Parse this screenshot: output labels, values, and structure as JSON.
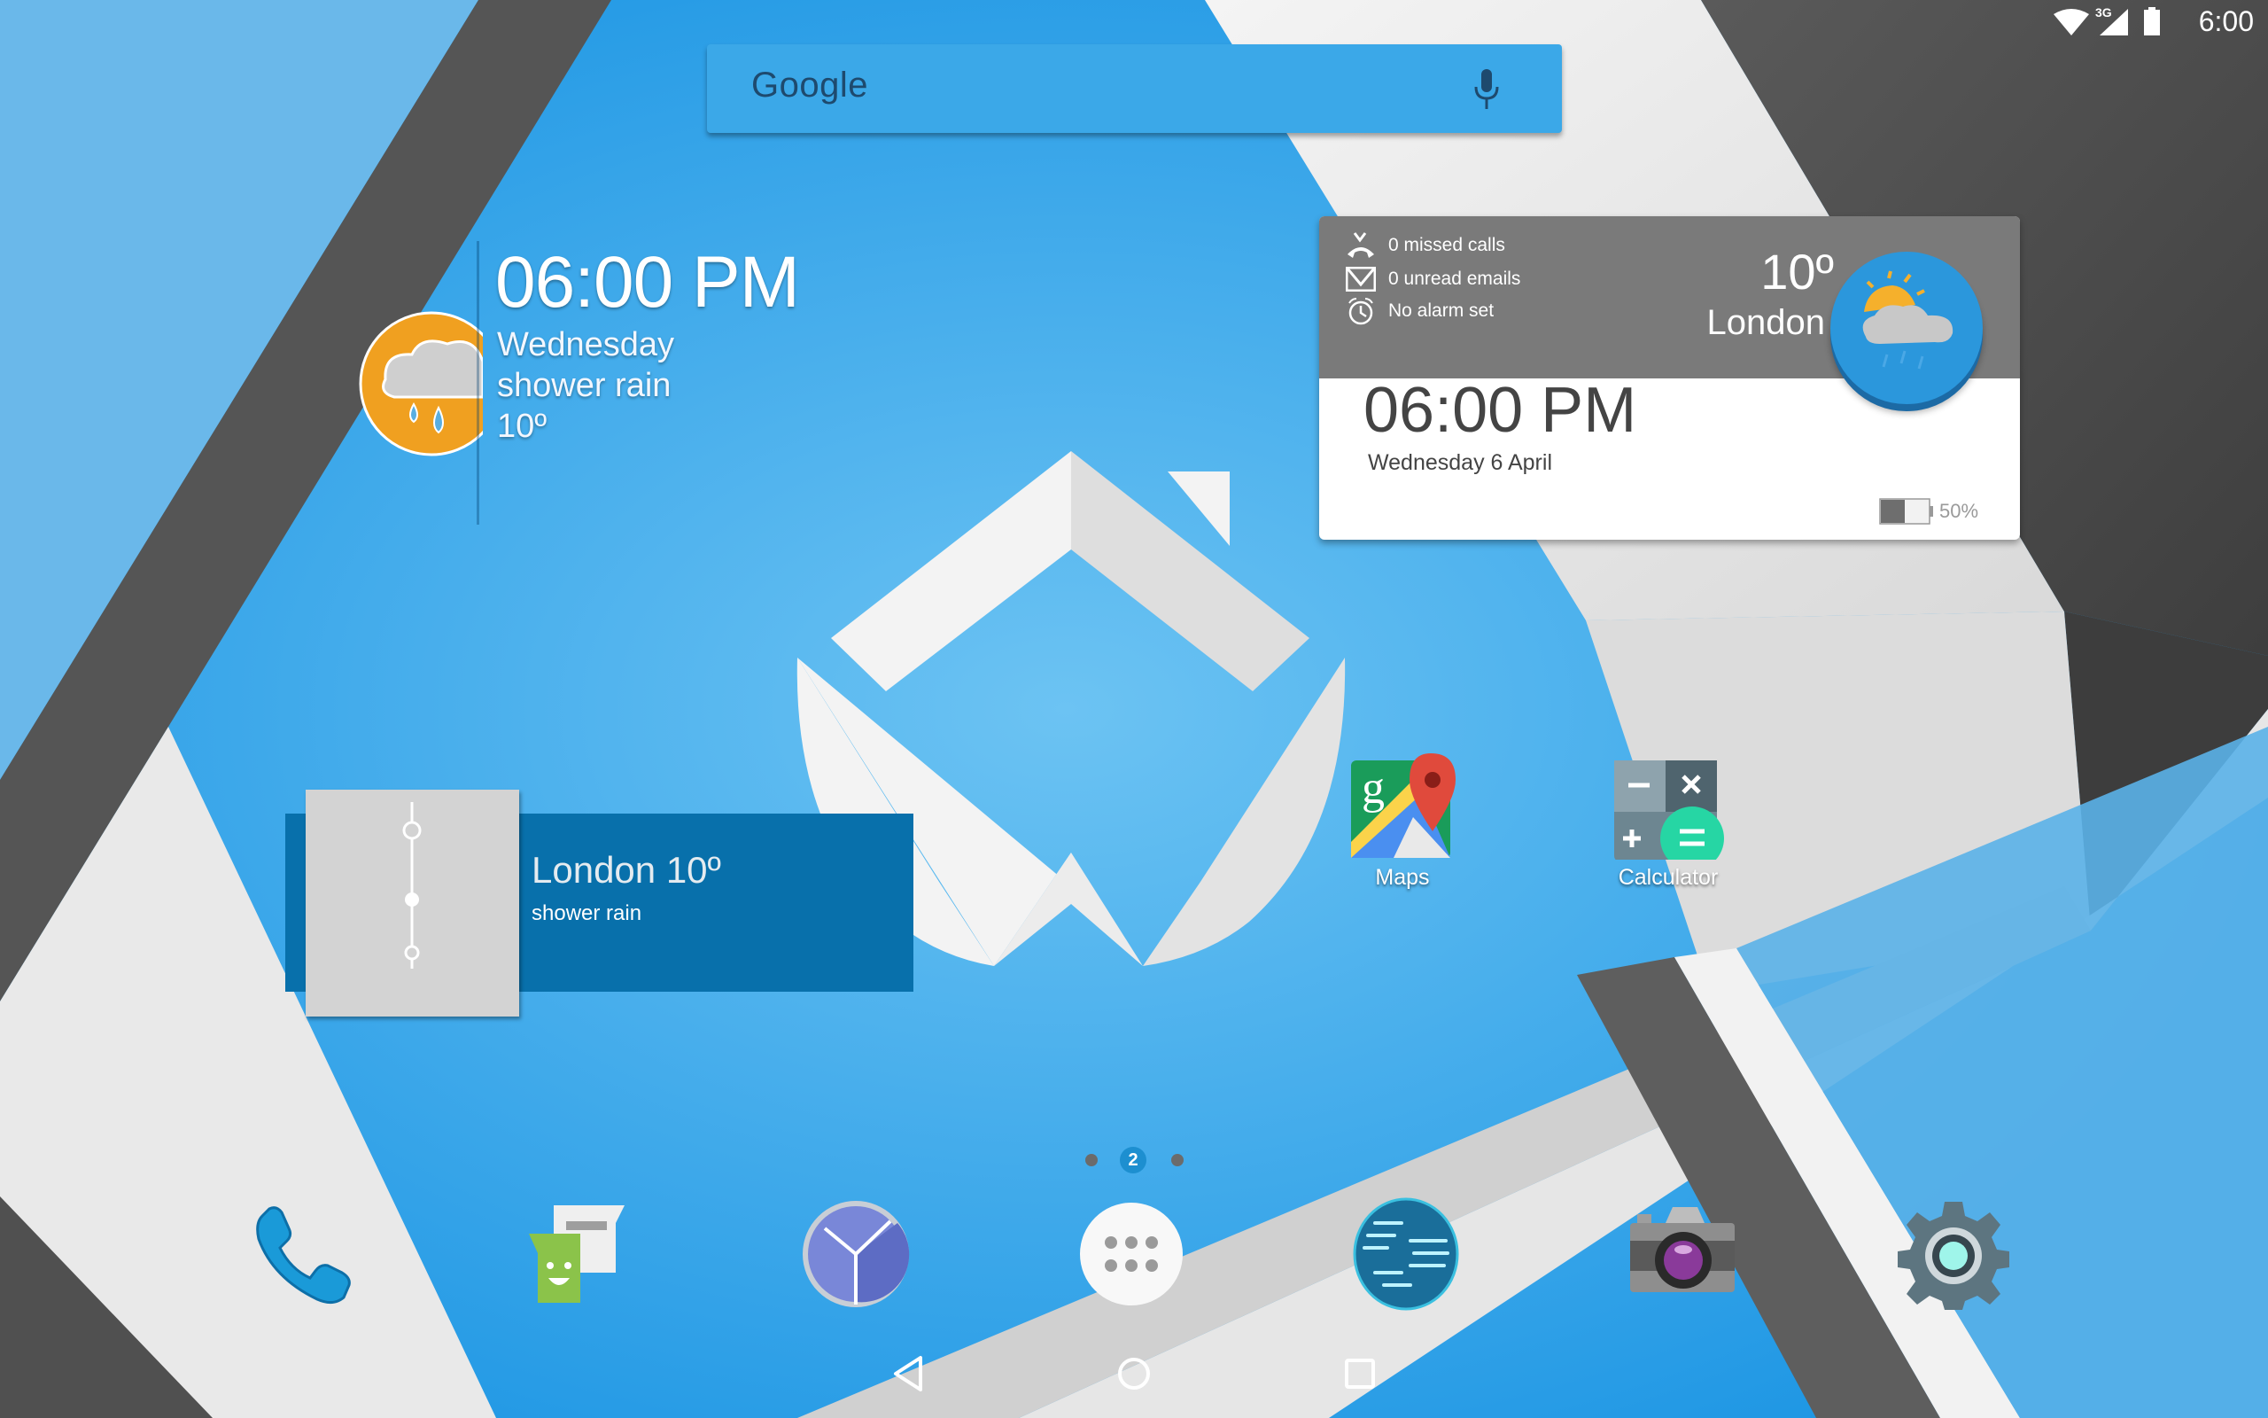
{
  "status_bar": {
    "network_type": "3G",
    "time": "6:00",
    "icons": [
      "wifi-icon",
      "cell-signal-icon",
      "battery-icon"
    ]
  },
  "search": {
    "logo_text": "Google",
    "voice_icon": "mic-icon"
  },
  "clock_widget_left": {
    "time": "06:00 PM",
    "day": "Wednesday",
    "condition": "shower rain",
    "temperature": "10º",
    "icon": "rain-cloud-icon"
  },
  "info_widget": {
    "missed_calls": "0 missed calls",
    "unread_emails": "0  unread emails",
    "alarm": "No alarm set",
    "temperature": "10º",
    "city": "London",
    "time": "06:00 PM",
    "date": "Wednesday   6 April",
    "battery_percent": "50%",
    "battery_level": 0.5,
    "weather_icon": "partly-cloudy-rain-icon"
  },
  "london_widget": {
    "title": "London 10º",
    "condition": "shower rain"
  },
  "apps": [
    {
      "label": "Maps",
      "icon": "maps-icon"
    },
    {
      "label": "Calculator",
      "icon": "calculator-icon"
    }
  ],
  "page_indicator": {
    "current": "2",
    "total": 3
  },
  "dock": [
    {
      "name": "phone",
      "icon": "phone-icon"
    },
    {
      "name": "messaging",
      "icon": "messaging-icon"
    },
    {
      "name": "clock",
      "icon": "clock-icon"
    },
    {
      "name": "app-drawer",
      "icon": "app-drawer-icon"
    },
    {
      "name": "browser",
      "icon": "globe-icon"
    },
    {
      "name": "camera",
      "icon": "camera-icon"
    },
    {
      "name": "settings",
      "icon": "settings-gear-icon"
    }
  ],
  "nav_bar": {
    "buttons": [
      "back",
      "home",
      "recents"
    ]
  },
  "colors": {
    "wallpaper_blue": "#2a9fe6",
    "search_bar": "#3ba8e8",
    "widget_header": "#7a7a7a",
    "london_widget": "#0870ab",
    "page_dot_active": "#1d8fd0"
  }
}
